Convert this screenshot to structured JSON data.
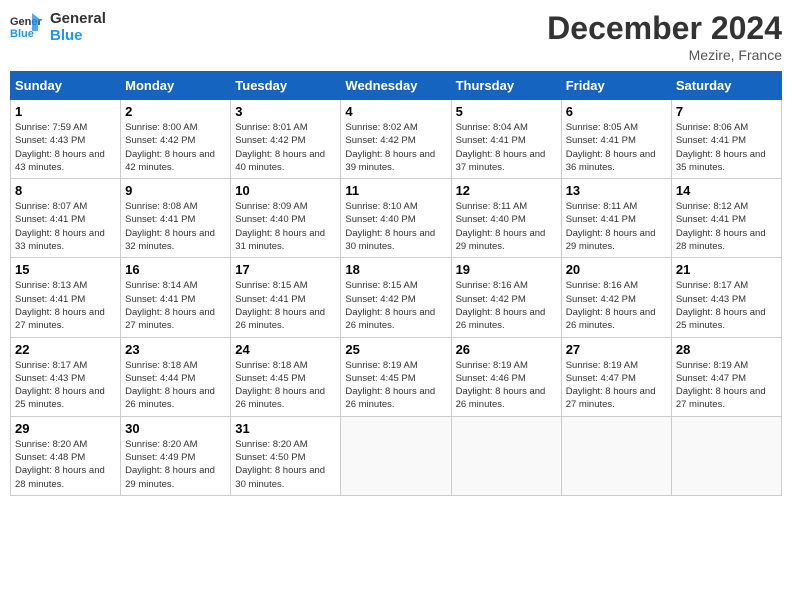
{
  "header": {
    "logo_line1": "General",
    "logo_line2": "Blue",
    "title": "December 2024",
    "location": "Mezire, France"
  },
  "columns": [
    "Sunday",
    "Monday",
    "Tuesday",
    "Wednesday",
    "Thursday",
    "Friday",
    "Saturday"
  ],
  "weeks": [
    [
      {
        "day": "1",
        "sunrise": "7:59 AM",
        "sunset": "4:43 PM",
        "daylight": "8 hours and 43 minutes."
      },
      {
        "day": "2",
        "sunrise": "8:00 AM",
        "sunset": "4:42 PM",
        "daylight": "8 hours and 42 minutes."
      },
      {
        "day": "3",
        "sunrise": "8:01 AM",
        "sunset": "4:42 PM",
        "daylight": "8 hours and 40 minutes."
      },
      {
        "day": "4",
        "sunrise": "8:02 AM",
        "sunset": "4:42 PM",
        "daylight": "8 hours and 39 minutes."
      },
      {
        "day": "5",
        "sunrise": "8:04 AM",
        "sunset": "4:41 PM",
        "daylight": "8 hours and 37 minutes."
      },
      {
        "day": "6",
        "sunrise": "8:05 AM",
        "sunset": "4:41 PM",
        "daylight": "8 hours and 36 minutes."
      },
      {
        "day": "7",
        "sunrise": "8:06 AM",
        "sunset": "4:41 PM",
        "daylight": "8 hours and 35 minutes."
      }
    ],
    [
      {
        "day": "8",
        "sunrise": "8:07 AM",
        "sunset": "4:41 PM",
        "daylight": "8 hours and 33 minutes."
      },
      {
        "day": "9",
        "sunrise": "8:08 AM",
        "sunset": "4:41 PM",
        "daylight": "8 hours and 32 minutes."
      },
      {
        "day": "10",
        "sunrise": "8:09 AM",
        "sunset": "4:40 PM",
        "daylight": "8 hours and 31 minutes."
      },
      {
        "day": "11",
        "sunrise": "8:10 AM",
        "sunset": "4:40 PM",
        "daylight": "8 hours and 30 minutes."
      },
      {
        "day": "12",
        "sunrise": "8:11 AM",
        "sunset": "4:40 PM",
        "daylight": "8 hours and 29 minutes."
      },
      {
        "day": "13",
        "sunrise": "8:11 AM",
        "sunset": "4:41 PM",
        "daylight": "8 hours and 29 minutes."
      },
      {
        "day": "14",
        "sunrise": "8:12 AM",
        "sunset": "4:41 PM",
        "daylight": "8 hours and 28 minutes."
      }
    ],
    [
      {
        "day": "15",
        "sunrise": "8:13 AM",
        "sunset": "4:41 PM",
        "daylight": "8 hours and 27 minutes."
      },
      {
        "day": "16",
        "sunrise": "8:14 AM",
        "sunset": "4:41 PM",
        "daylight": "8 hours and 27 minutes."
      },
      {
        "day": "17",
        "sunrise": "8:15 AM",
        "sunset": "4:41 PM",
        "daylight": "8 hours and 26 minutes."
      },
      {
        "day": "18",
        "sunrise": "8:15 AM",
        "sunset": "4:42 PM",
        "daylight": "8 hours and 26 minutes."
      },
      {
        "day": "19",
        "sunrise": "8:16 AM",
        "sunset": "4:42 PM",
        "daylight": "8 hours and 26 minutes."
      },
      {
        "day": "20",
        "sunrise": "8:16 AM",
        "sunset": "4:42 PM",
        "daylight": "8 hours and 26 minutes."
      },
      {
        "day": "21",
        "sunrise": "8:17 AM",
        "sunset": "4:43 PM",
        "daylight": "8 hours and 25 minutes."
      }
    ],
    [
      {
        "day": "22",
        "sunrise": "8:17 AM",
        "sunset": "4:43 PM",
        "daylight": "8 hours and 25 minutes."
      },
      {
        "day": "23",
        "sunrise": "8:18 AM",
        "sunset": "4:44 PM",
        "daylight": "8 hours and 26 minutes."
      },
      {
        "day": "24",
        "sunrise": "8:18 AM",
        "sunset": "4:45 PM",
        "daylight": "8 hours and 26 minutes."
      },
      {
        "day": "25",
        "sunrise": "8:19 AM",
        "sunset": "4:45 PM",
        "daylight": "8 hours and 26 minutes."
      },
      {
        "day": "26",
        "sunrise": "8:19 AM",
        "sunset": "4:46 PM",
        "daylight": "8 hours and 26 minutes."
      },
      {
        "day": "27",
        "sunrise": "8:19 AM",
        "sunset": "4:47 PM",
        "daylight": "8 hours and 27 minutes."
      },
      {
        "day": "28",
        "sunrise": "8:19 AM",
        "sunset": "4:47 PM",
        "daylight": "8 hours and 27 minutes."
      }
    ],
    [
      {
        "day": "29",
        "sunrise": "8:20 AM",
        "sunset": "4:48 PM",
        "daylight": "8 hours and 28 minutes."
      },
      {
        "day": "30",
        "sunrise": "8:20 AM",
        "sunset": "4:49 PM",
        "daylight": "8 hours and 29 minutes."
      },
      {
        "day": "31",
        "sunrise": "8:20 AM",
        "sunset": "4:50 PM",
        "daylight": "8 hours and 30 minutes."
      },
      null,
      null,
      null,
      null
    ]
  ]
}
